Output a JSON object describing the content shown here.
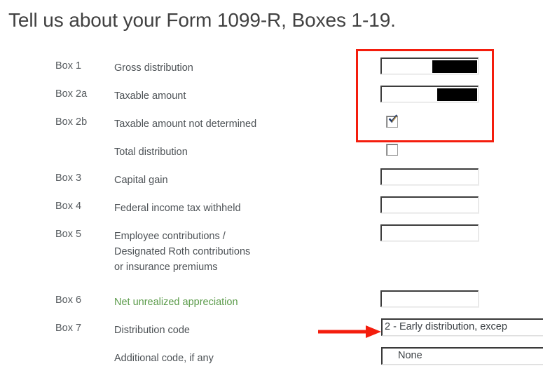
{
  "page": {
    "title": "Tell us about your Form 1099-R, Boxes 1-19."
  },
  "colors": {
    "annotation_red": "#f41d0d",
    "label_gray": "#4d5256",
    "box_number_gray": "#555a5e",
    "link_green": "#5b9b4a",
    "redaction_black": "#000000",
    "title_gray": "#414141",
    "page_background": "#ffffff"
  },
  "rows": [
    {
      "box_number": "Box 1",
      "label": "Gross distribution",
      "control": "text-input",
      "value": "",
      "redacted": true
    },
    {
      "box_number": "Box 2a",
      "label": "Taxable amount",
      "control": "text-input",
      "value": "",
      "redacted": true
    },
    {
      "box_number": "Box 2b",
      "label": "Taxable amount not determined",
      "control": "checkbox",
      "checked": true
    },
    {
      "box_number": "",
      "label": "Total distribution",
      "control": "checkbox",
      "checked": false
    },
    {
      "box_number": "Box 3",
      "label": "Capital gain",
      "control": "text-input",
      "value": "",
      "redacted": false
    },
    {
      "box_number": "Box 4",
      "label": "Federal income tax withheld",
      "control": "text-input",
      "value": "",
      "redacted": false
    },
    {
      "box_number": "Box 5",
      "label_line1": "Employee contributions /",
      "label_line2": "Designated Roth contributions",
      "label_line3": "or insurance premiums",
      "control": "text-input",
      "value": "",
      "redacted": false
    },
    {
      "box_number": "Box 6",
      "label": "Net unrealized appreciation",
      "label_style": "green-link",
      "control": "text-input",
      "value": "",
      "redacted": false
    },
    {
      "box_number": "Box 7",
      "label": "Distribution code",
      "control": "dropdown",
      "value": "2 - Early distribution, excep"
    },
    {
      "box_number": "",
      "label": "Additional code, if any",
      "control": "dropdown",
      "value": "None"
    }
  ],
  "annotations": {
    "highlight_rect": {
      "shape": "rectangle",
      "color": "#f41d0d",
      "encloses": "Box 1, Box 2a inputs and Box 2b checkbox"
    },
    "pointer_arrow": {
      "shape": "arrow-right",
      "color": "#f41d0d",
      "points_to": "Box 7 distribution code dropdown"
    }
  }
}
